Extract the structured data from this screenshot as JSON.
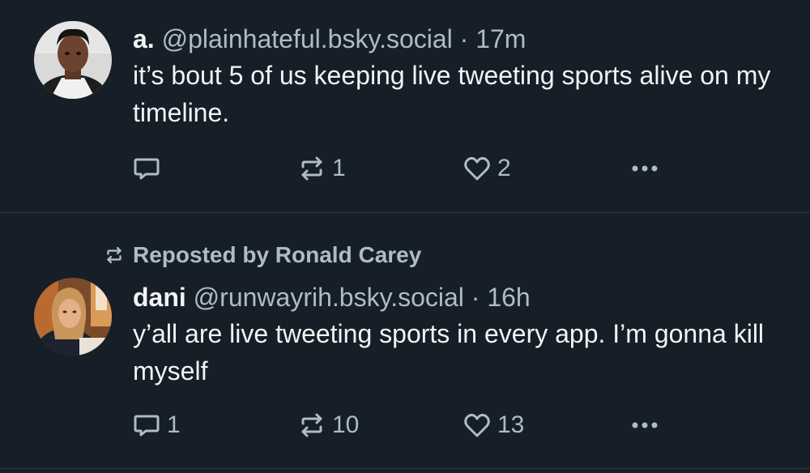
{
  "posts": [
    {
      "author_name": "a.",
      "handle": "@plainhateful.bsky.social",
      "separator": "·",
      "time": "17m",
      "text": "it’s bout 5 of us keeping live tweeting sports alive on my timeline.",
      "reply_count": "",
      "repost_count": "1",
      "like_count": "2",
      "avatar_icon": "avatar-photo"
    },
    {
      "repost_label": "Reposted by Ronald Carey",
      "author_name": "dani",
      "handle": "@runwayrih.bsky.social",
      "separator": "·",
      "time": "16h",
      "text": "y’all are live tweeting sports in every app. I’m gonna kill myself",
      "reply_count": "1",
      "repost_count": "10",
      "like_count": "13",
      "avatar_icon": "avatar-photo"
    }
  ],
  "icons": {
    "reply": "reply-bubble-icon",
    "repost": "repost-arrows-icon",
    "like": "heart-icon",
    "more": "more-dots-icon"
  },
  "colors": {
    "background": "#161e27",
    "primary_text": "#f1f3f5",
    "secondary_text": "#aebbc9",
    "divider": "#2e3a48"
  }
}
